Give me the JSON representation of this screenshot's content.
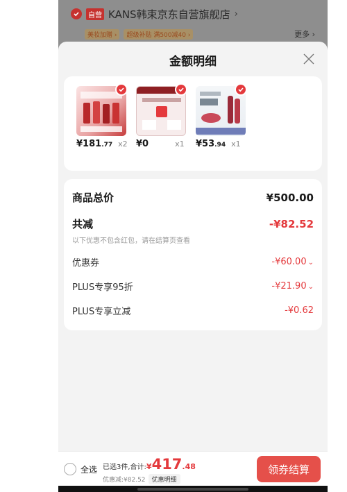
{
  "background_store": {
    "self_operated_tag": "自营",
    "store_name": "KANS韩束京东自营旗舰店",
    "arrow": "›",
    "promos": [
      "美妆加赠 ›",
      "超级补贴 满500减40 ›"
    ],
    "more": "更多 ›"
  },
  "sheet": {
    "title": "金额明细",
    "close_icon": "close-icon"
  },
  "products": [
    {
      "price_symbol": "¥",
      "price_int": "181",
      "price_dec": ".77",
      "qty": "x2"
    },
    {
      "price_symbol": "¥",
      "price_int": "0",
      "price_dec": "",
      "qty": "x1"
    },
    {
      "price_symbol": "¥",
      "price_int": "53",
      "price_dec": ".94",
      "qty": "x1"
    }
  ],
  "details": {
    "goods_total_label": "商品总价",
    "goods_total_value": "¥500.00",
    "total_discount_label": "共减",
    "total_discount_value": "-¥82.52",
    "note": "以下优惠不包含红包，请在结算页查看",
    "rows": [
      {
        "label": "优惠券",
        "value": "-¥60.00",
        "expandable": true
      },
      {
        "label": "PLUS专享95折",
        "value": "-¥21.90",
        "expandable": true
      },
      {
        "label": "PLUS专享立减",
        "value": "-¥0.62",
        "expandable": false
      }
    ]
  },
  "bottom_bar": {
    "select_all": "全选",
    "selected_summary": "已选3件,合计:",
    "total_symbol": "¥",
    "total_int": "417",
    "total_dec": ".48",
    "discount_text": "优惠减:¥82.52",
    "detail_pill": "优惠明细",
    "checkout_button": "领券结算"
  },
  "colors": {
    "accent_red": "#e4393c",
    "checkout_red": "#e5504a",
    "sheet_bg": "#f3f3f3"
  }
}
